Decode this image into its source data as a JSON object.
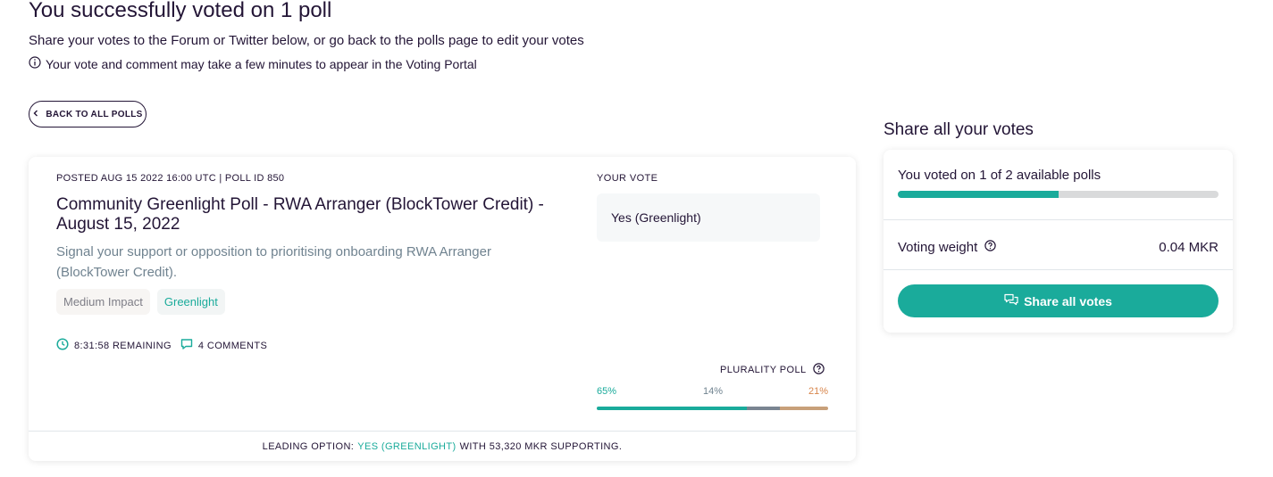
{
  "header": {
    "title": "You successfully voted on 1 poll",
    "subtitle": "Share your votes to the Forum or Twitter below, or go back to the polls page to edit your votes",
    "notice": "Your vote and comment may take a few minutes to appear in the Voting Portal",
    "notice_icon": "info-icon"
  },
  "back_button": {
    "label": "BACK TO ALL POLLS",
    "icon": "chevron-left-icon"
  },
  "poll": {
    "meta": "POSTED AUG 15 2022 16:00 UTC | POLL ID 850",
    "title": "Community Greenlight Poll - RWA Arranger (BlockTower Credit) - August 15, 2022",
    "description": "Signal your support or opposition to prioritising onboarding RWA Arranger (BlockTower Credit).",
    "tags": [
      "Medium Impact",
      "Greenlight"
    ],
    "remaining": "8:31:58 REMAINING",
    "comments": "4 COMMENTS",
    "your_vote_label": "YOUR VOTE",
    "your_vote": "Yes (Greenlight)",
    "poll_type": "PLURALITY POLL",
    "results": {
      "percents": [
        "65%",
        "14%",
        "21%"
      ],
      "values": [
        65,
        14,
        21
      ],
      "colors": [
        "#1aab9b",
        "#7a8591",
        "#c8a07a"
      ]
    },
    "leading": {
      "prefix": "LEADING OPTION:",
      "option": "YES (GREENLIGHT)",
      "suffix": "WITH 53,320 MKR SUPPORTING."
    }
  },
  "share_panel": {
    "heading": "Share all your votes",
    "voted_text": "You voted on 1 of 2 available polls",
    "progress_fraction": 0.5,
    "weight_label": "Voting weight",
    "weight_value": "0.04 MKR",
    "share_button": "Share all votes"
  },
  "colors": {
    "accent": "#1aab9b",
    "text": "#231536",
    "muted": "#708390"
  }
}
